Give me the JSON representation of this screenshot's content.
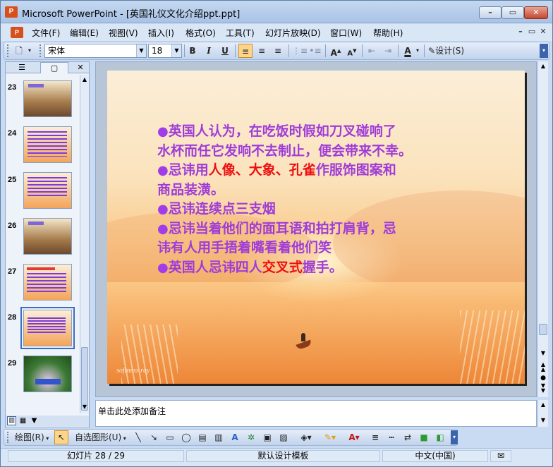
{
  "window": {
    "title": "Microsoft PowerPoint - [英国礼仪文化介绍ppt.ppt]",
    "controls": {
      "minimize": "–",
      "restore": "▭",
      "close": "✕"
    }
  },
  "menubar": {
    "items": [
      "文件(F)",
      "编辑(E)",
      "视图(V)",
      "插入(I)",
      "格式(O)",
      "工具(T)",
      "幻灯片放映(D)",
      "窗口(W)",
      "帮助(H)"
    ]
  },
  "toolbar": {
    "font": "宋体",
    "font_size": "18",
    "bold": "B",
    "italic": "I",
    "underline": "U",
    "design_label": "设计(S)"
  },
  "thumbnails": [
    {
      "num": "23"
    },
    {
      "num": "24"
    },
    {
      "num": "25"
    },
    {
      "num": "26"
    },
    {
      "num": "27"
    },
    {
      "num": "28",
      "selected": true
    },
    {
      "num": "29"
    }
  ],
  "slide": {
    "lines": [
      {
        "segments": [
          {
            "t": "●",
            "bullet": true
          },
          {
            "t": "英国人认为，在吃饭时假如刀叉碰响了"
          }
        ]
      },
      {
        "segments": [
          {
            "t": "水杯而任它发响不去制止，便会带来不幸。"
          }
        ]
      },
      {
        "segments": [
          {
            "t": "●",
            "bullet": true
          },
          {
            "t": "忌讳用"
          },
          {
            "t": "人像、大象、孔雀",
            "red": true
          },
          {
            "t": "作服饰图案和"
          }
        ]
      },
      {
        "segments": [
          {
            "t": "商品装潢。"
          }
        ]
      },
      {
        "segments": [
          {
            "t": "●",
            "bullet": true
          },
          {
            "t": "忌讳连续点三支烟"
          }
        ]
      },
      {
        "segments": [
          {
            "t": "●",
            "bullet": true
          },
          {
            "t": "忌讳当着他们的面耳语和拍打肩背，忌"
          }
        ]
      },
      {
        "segments": [
          {
            "t": "讳有人用手捂着嘴看着他们笑"
          }
        ]
      },
      {
        "segments": [
          {
            "t": "●",
            "bullet": true
          },
          {
            "t": "英国人忌讳四人"
          },
          {
            "t": "交叉式",
            "red": true
          },
          {
            "t": "握手。"
          }
        ]
      }
    ],
    "watermark": "softness  ray"
  },
  "notes": {
    "placeholder": "单击此处添加备注"
  },
  "drawbar": {
    "draw_label": "绘图(R)",
    "autoshape_label": "自选图形(U)"
  },
  "status": {
    "slide_info": "幻灯片 28 / 29",
    "template": "默认设计模板",
    "language": "中文(中国)"
  },
  "colors": {
    "slide_text": "#9f3cd8",
    "slide_highlight": "#ee1010",
    "accent_selection": "#3b6dc4"
  }
}
